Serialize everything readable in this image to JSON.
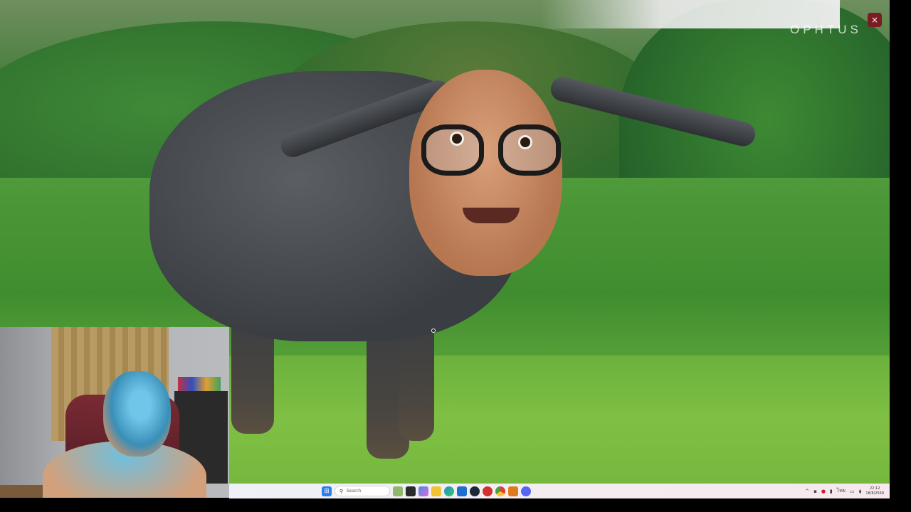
{
  "viewer": {
    "watermark": "OPHTUS",
    "close_icon": "×"
  },
  "taskbar": {
    "search_placeholder": "Search",
    "icons": [
      "windows-start-icon",
      "search-icon",
      "widgets-icon",
      "task-view-icon",
      "copilot-icon",
      "file-explorer-icon",
      "edge-icon",
      "store-icon",
      "steam-icon",
      "game-launcher-icon",
      "chrome-icon",
      "app-icon",
      "discord-icon"
    ],
    "tray": {
      "lang": "ไทย",
      "time": "22:12",
      "date": "18/8/2569"
    }
  },
  "colors": {
    "close_button": "#7a1d22",
    "taskbar_bg": "#eef1f7"
  }
}
